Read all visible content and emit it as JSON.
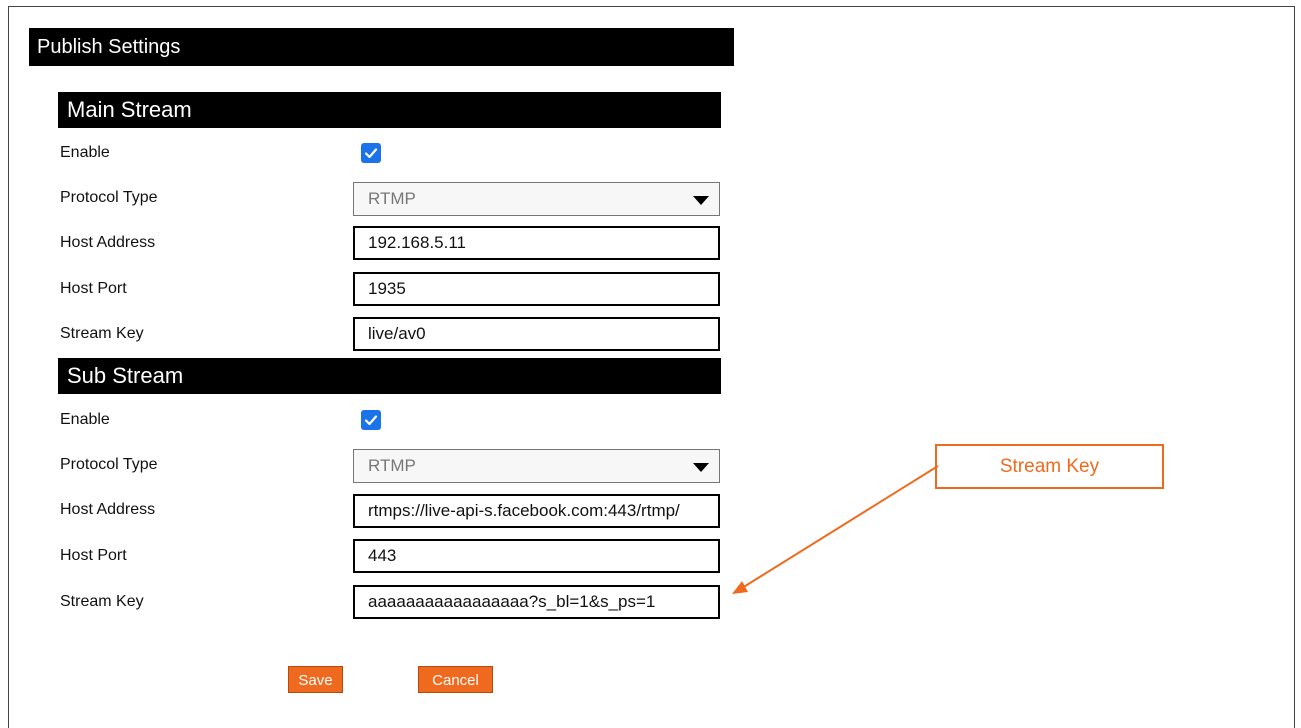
{
  "page_title": "Publish Settings",
  "main_stream": {
    "header": "Main Stream",
    "enable_label": "Enable",
    "enable_checked": true,
    "protocol_label": "Protocol Type",
    "protocol_value": "RTMP",
    "host_address_label": "Host Address",
    "host_address_value": "192.168.5.11",
    "host_port_label": "Host Port",
    "host_port_value": "1935",
    "stream_key_label": "Stream Key",
    "stream_key_value": "live/av0"
  },
  "sub_stream": {
    "header": "Sub Stream",
    "enable_label": "Enable",
    "enable_checked": true,
    "protocol_label": "Protocol Type",
    "protocol_value": "RTMP",
    "host_address_label": "Host Address",
    "host_address_value": "rtmps://live-api-s.facebook.com:443/rtmp/",
    "host_port_label": "Host Port",
    "host_port_value": "443",
    "stream_key_label": "Stream Key",
    "stream_key_value": "aaaaaaaaaaaaaaaaa?s_bl=1&s_ps=1"
  },
  "buttons": {
    "save_label": "Save",
    "cancel_label": "Cancel"
  },
  "annotation": {
    "callout_text": "Stream Key"
  },
  "colors": {
    "accent": "#ef6a1f",
    "checkbox": "#1a73e8",
    "header_bg": "#000000"
  },
  "icons": {
    "checkbox_checked": "check-icon",
    "dropdown": "chevron-down-icon"
  }
}
